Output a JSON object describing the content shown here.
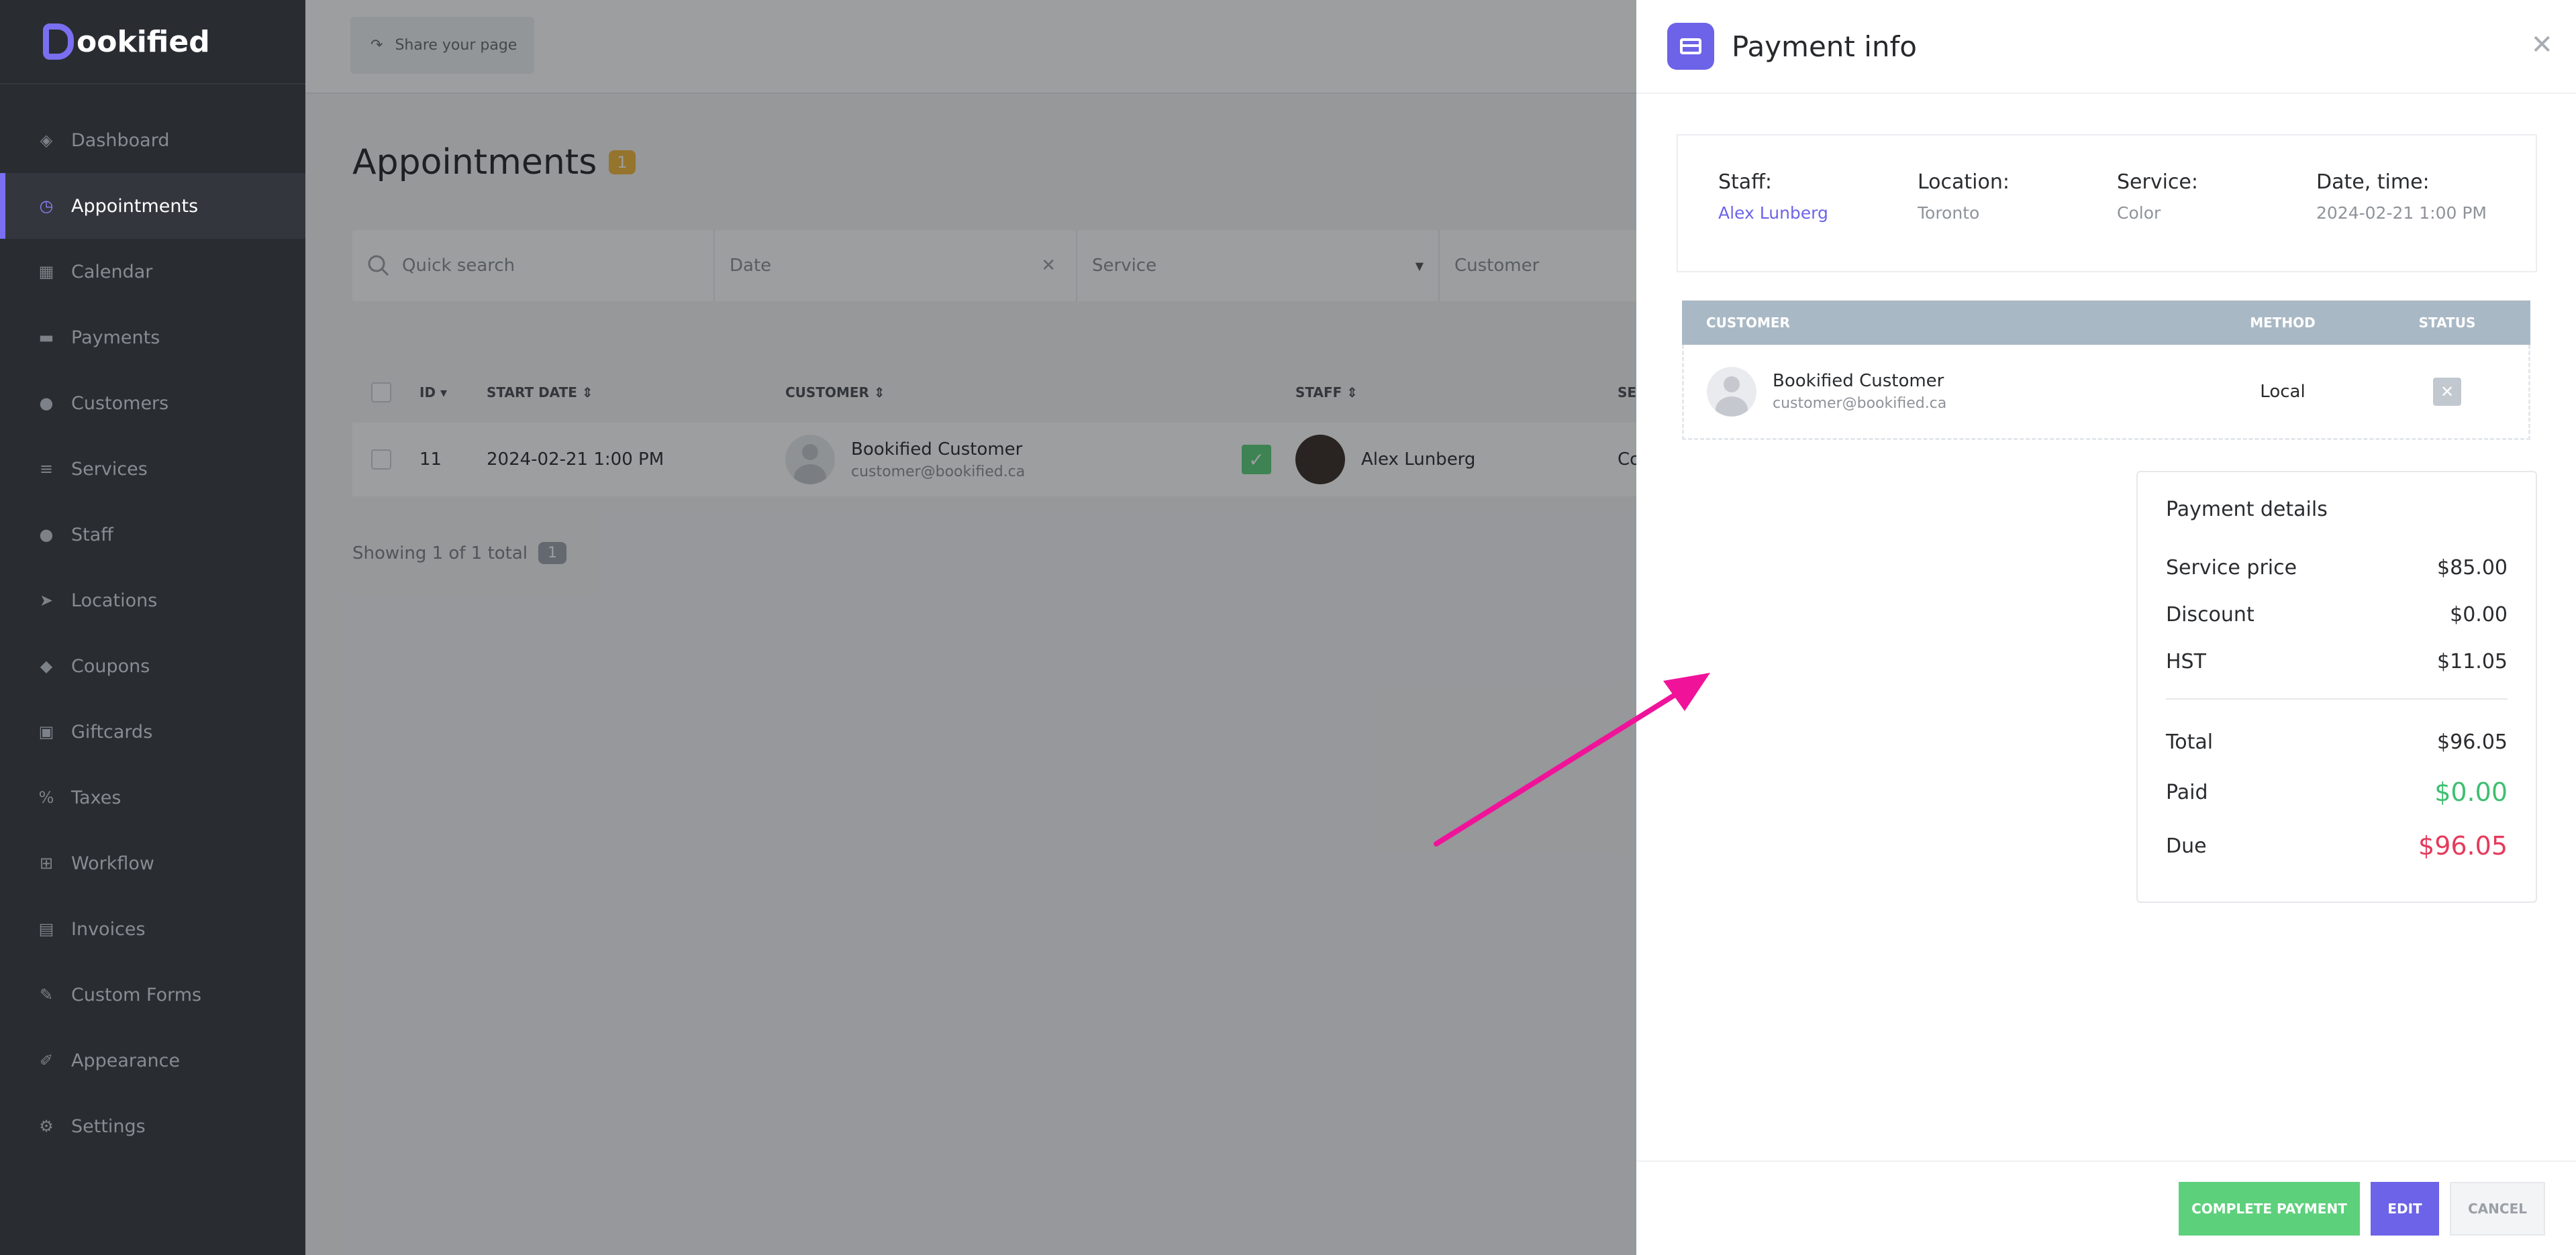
{
  "brand": {
    "logo_text": "ookified"
  },
  "sidebar": {
    "items": [
      {
        "label": "Dashboard",
        "icon": "cube-icon"
      },
      {
        "label": "Appointments",
        "icon": "clock-icon"
      },
      {
        "label": "Calendar",
        "icon": "calendar-icon"
      },
      {
        "label": "Payments",
        "icon": "credit-card-icon"
      },
      {
        "label": "Customers",
        "icon": "users-icon"
      },
      {
        "label": "Services",
        "icon": "list-icon"
      },
      {
        "label": "Staff",
        "icon": "user-icon"
      },
      {
        "label": "Locations",
        "icon": "location-arrow-icon"
      },
      {
        "label": "Coupons",
        "icon": "tag-icon"
      },
      {
        "label": "Giftcards",
        "icon": "gift-icon"
      },
      {
        "label": "Taxes",
        "icon": "percent-icon"
      },
      {
        "label": "Workflow",
        "icon": "workflow-icon"
      },
      {
        "label": "Invoices",
        "icon": "file-icon"
      },
      {
        "label": "Custom Forms",
        "icon": "magic-icon"
      },
      {
        "label": "Appearance",
        "icon": "brush-icon"
      },
      {
        "label": "Settings",
        "icon": "gear-icon"
      }
    ],
    "active": "Appointments"
  },
  "topbar": {
    "share_label": "Share your page"
  },
  "page": {
    "title": "Appointments",
    "count": "1"
  },
  "filters": {
    "search_placeholder": "Quick search",
    "date_placeholder": "Date",
    "service_placeholder": "Service",
    "customer_placeholder": "Customer"
  },
  "table": {
    "headers": {
      "id": "ID",
      "start_date": "START DATE",
      "customer": "CUSTOMER",
      "staff": "STAFF",
      "service": "SEI"
    },
    "rows": [
      {
        "id": "11",
        "start_date": "2024-02-21 1:00 PM",
        "customer_name": "Bookified Customer",
        "customer_email": "customer@bookified.ca",
        "staff": "Alex Lunberg",
        "service": "Co"
      }
    ],
    "showing": "Showing 1 of 1 total",
    "page": "1"
  },
  "panel": {
    "title": "Payment info",
    "info": {
      "staff_label": "Staff:",
      "staff_value": "Alex Lunberg",
      "location_label": "Location:",
      "location_value": "Toronto",
      "service_label": "Service:",
      "service_value": "Color",
      "datetime_label": "Date, time:",
      "datetime_value": "2024-02-21 1:00 PM"
    },
    "customers_table": {
      "headers": {
        "customer": "CUSTOMER",
        "method": "METHOD",
        "status": "STATUS"
      },
      "row": {
        "name": "Bookified Customer",
        "email": "customer@bookified.ca",
        "method": "Local"
      }
    },
    "details": {
      "heading": "Payment details",
      "service_price_label": "Service price",
      "service_price": "$85.00",
      "discount_label": "Discount",
      "discount": "$0.00",
      "hst_label": "HST",
      "hst": "$11.05",
      "total_label": "Total",
      "total": "$96.05",
      "paid_label": "Paid",
      "paid": "$0.00",
      "due_label": "Due",
      "due": "$96.05"
    },
    "buttons": {
      "complete": "COMPLETE PAYMENT",
      "edit": "EDIT",
      "cancel": "CANCEL"
    }
  },
  "colors": {
    "accent": "#6c63e8",
    "green": "#5dd07c",
    "paid": "#3fbf71",
    "due": "#e53a5c",
    "annotation": "#f0139a"
  }
}
